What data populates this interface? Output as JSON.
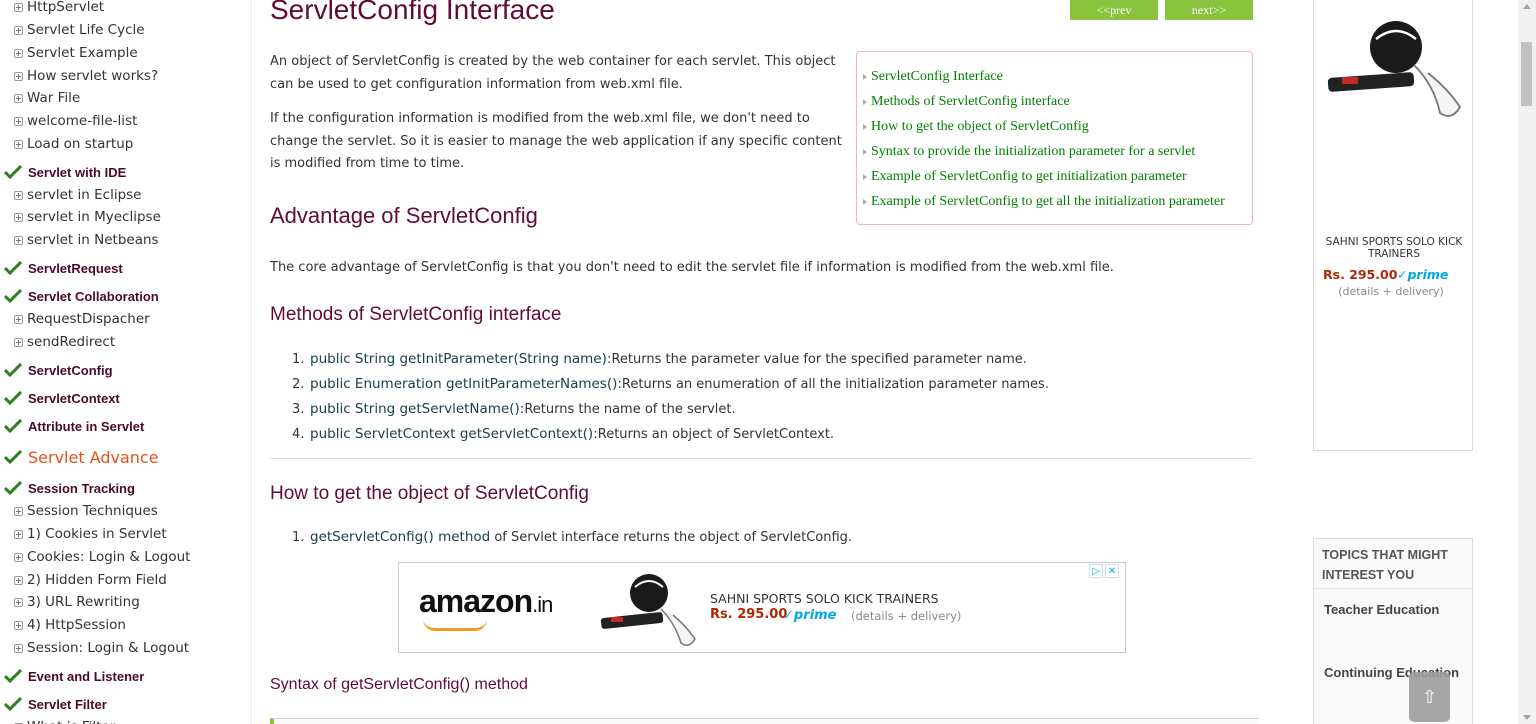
{
  "sidebar": {
    "items": [
      {
        "type": "sub",
        "label": "HttpServlet"
      },
      {
        "type": "sub",
        "label": "Servlet Life Cycle"
      },
      {
        "type": "sub",
        "label": "Servlet Example"
      },
      {
        "type": "sub",
        "label": "How servlet works?"
      },
      {
        "type": "sub",
        "label": "War File"
      },
      {
        "type": "sub",
        "label": "welcome-file-list"
      },
      {
        "type": "sub",
        "label": "Load on startup"
      },
      {
        "type": "head",
        "label": "Servlet with IDE"
      },
      {
        "type": "sub",
        "label": "servlet in Eclipse"
      },
      {
        "type": "sub",
        "label": "servlet in Myeclipse"
      },
      {
        "type": "sub",
        "label": "servlet in Netbeans"
      },
      {
        "type": "head",
        "label": "ServletRequest"
      },
      {
        "type": "head",
        "label": "Servlet Collaboration"
      },
      {
        "type": "sub",
        "label": "RequestDispacher"
      },
      {
        "type": "sub",
        "label": "sendRedirect"
      },
      {
        "type": "head",
        "label": "ServletConfig"
      },
      {
        "type": "head",
        "label": "ServletContext"
      },
      {
        "type": "head",
        "label": "Attribute in Servlet"
      },
      {
        "type": "head-orange",
        "label": "Servlet Advance"
      },
      {
        "type": "head",
        "label": "Session Tracking"
      },
      {
        "type": "sub",
        "label": "Session Techniques"
      },
      {
        "type": "sub",
        "label": "1) Cookies in Servlet"
      },
      {
        "type": "sub",
        "label": "Cookies: Login & Logout"
      },
      {
        "type": "sub",
        "label": "2) Hidden Form Field"
      },
      {
        "type": "sub",
        "label": "3) URL Rewriting"
      },
      {
        "type": "sub",
        "label": "4) HttpSession"
      },
      {
        "type": "sub",
        "label": "Session: Login & Logout"
      },
      {
        "type": "head",
        "label": "Event and Listener"
      },
      {
        "type": "head",
        "label": "Servlet Filter"
      },
      {
        "type": "sub",
        "label": "What is Filter"
      }
    ]
  },
  "main": {
    "title": "ServletConfig Interface",
    "prev_label": "<<prev",
    "next_label": "next>>",
    "intro_p1": "An object of ServletConfig is created by the web container for each servlet. This object can be used to get configuration information from web.xml file.",
    "intro_p2": "If the configuration information is modified from the web.xml file, we don't need to change the servlet. So it is easier to manage the web application if any specific content is modified from time to time.",
    "toc": [
      "ServletConfig Interface",
      "Methods of ServletConfig interface",
      "How to get the object of ServletConfig",
      "Syntax to provide the initialization parameter for a servlet",
      "Example of ServletConfig to get initialization parameter",
      "Example of ServletConfig to get all the initialization parameter"
    ],
    "advantage_heading": "Advantage of ServletConfig",
    "advantage_text": "The core advantage of ServletConfig is that you don't need to edit the servlet file if information is modified from the web.xml file.",
    "methods_heading": "Methods of ServletConfig interface",
    "methods": [
      {
        "num": "1.",
        "code": "public String getInitParameter(String name):",
        "desc": "Returns the parameter value for the specified parameter name."
      },
      {
        "num": "2.",
        "code": "public Enumeration getInitParameterNames():",
        "desc": "Returns an enumeration of all the initialization parameter names."
      },
      {
        "num": "3.",
        "code": "public String getServletName():",
        "desc": "Returns the name of the servlet."
      },
      {
        "num": "4.",
        "code": "public ServletContext getServletContext():",
        "desc": "Returns an object of ServletContext."
      }
    ],
    "get_object_heading": "How to get the object of ServletConfig",
    "get_object_items": [
      {
        "num": "1.",
        "code": "getServletConfig() method",
        "desc": " of Servlet interface returns the object of ServletConfig."
      }
    ],
    "syntax_heading": "Syntax of getServletConfig() method"
  },
  "amazon_banner": {
    "logo_text": "amazon",
    "logo_suffix": ".in",
    "product_title": "SAHNI SPORTS SOLO KICK TRAINERS",
    "price": "Rs. 295.00",
    "prime": "✓prime",
    "details": "(details + delivery)"
  },
  "right_ad": {
    "product_title": "SAHNI SPORTS SOLO KICK TRAINERS",
    "price": "Rs. 295.00",
    "prime": "✓prime",
    "details": "(details + delivery)"
  },
  "topics": {
    "heading": "TOPICS THAT MIGHT INTEREST YOU",
    "items": [
      "Teacher Education",
      "Continuing Education"
    ],
    "to_top": "⇧"
  },
  "colors": {
    "heading": "#610b38",
    "toc_link": "#008000",
    "nav_button": "#8ac33e",
    "accent_orange": "#e2511a"
  }
}
